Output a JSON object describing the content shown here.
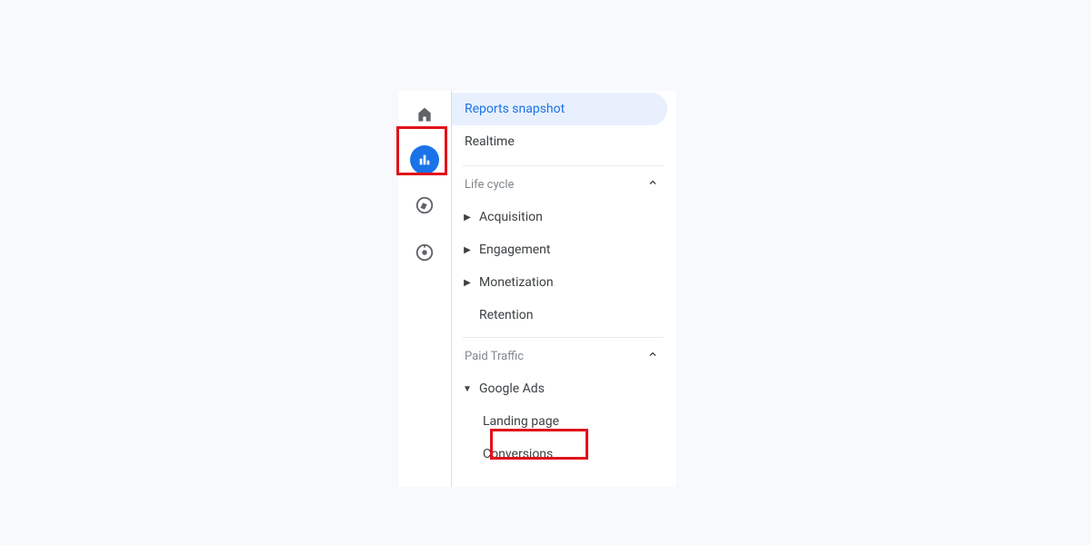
{
  "nav": {
    "top": [
      {
        "key": "reports_snapshot",
        "label": "Reports snapshot",
        "selected": true
      },
      {
        "key": "realtime",
        "label": "Realtime",
        "selected": false
      }
    ],
    "sections": [
      {
        "key": "life_cycle",
        "title": "Life cycle",
        "items": [
          {
            "key": "acquisition",
            "label": "Acquisition",
            "expandable": true
          },
          {
            "key": "engagement",
            "label": "Engagement",
            "expandable": true
          },
          {
            "key": "monetization",
            "label": "Monetization",
            "expandable": true
          },
          {
            "key": "retention",
            "label": "Retention",
            "expandable": false
          }
        ]
      },
      {
        "key": "paid_traffic",
        "title": "Paid Traffic",
        "items": [
          {
            "key": "google_ads",
            "label": "Google Ads",
            "expandable": true,
            "expanded": true,
            "children": [
              {
                "key": "landing_page",
                "label": "Landing page"
              },
              {
                "key": "conversions",
                "label": "Conversions"
              }
            ]
          }
        ]
      }
    ]
  },
  "rail": {
    "icons": [
      "home",
      "reports",
      "explore",
      "admin"
    ]
  }
}
